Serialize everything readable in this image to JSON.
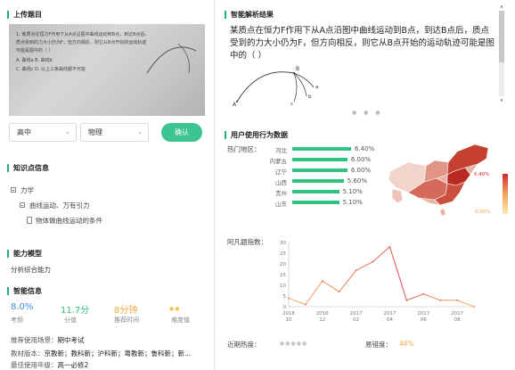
{
  "left": {
    "upload_title": "上传题目",
    "photo_lines": [
      "1. 某质点在恒力F作用下从A点沿图中曲线运动到B点，到达B点后，",
      "质点受到的力大小仍为F，但方向相反，则它从B点开始的运动轨迹",
      "可能是图中的（  ）",
      "A. 曲线a        B. 曲线b",
      "C. 曲线c        D. 以上三条曲线都不可能"
    ],
    "grade_select": "高中",
    "subject_select": "物理",
    "confirm_label": "确认",
    "knowledge_title": "知识点信息",
    "knowledge_tree": [
      "力学",
      "曲线运动、万有引力",
      "物体做曲线运动的条件"
    ],
    "ability_title": "能力模型",
    "ability_value": "分析综合能力",
    "smart_title": "智能信息",
    "stats": [
      {
        "value": "8.0%",
        "label": "考频",
        "color": "#3d8de0"
      },
      {
        "value": "11.7分",
        "label": "分值",
        "color": "#2fbf7a"
      },
      {
        "value": "8分钟",
        "label": "推荐时间",
        "color": "#f2a93b"
      },
      {
        "value": "●●",
        "label": "难度值",
        "color": "#f2c94c"
      }
    ],
    "recommend_label": "推荐使用场景：",
    "recommend_value": "期中考试",
    "textbook_label": "教材版本：",
    "textbook_value": "京教新；教科新；沪科新；粤教新；鲁科新；新...",
    "grade_label": "最佳使用年级：",
    "grade_value": "高一必修2"
  },
  "right": {
    "analysis_title": "智能解析结果",
    "question_text": "某质点在恒力F作用下从A点沿图中曲线运动到B点，到达B点后，质点受到的力大小仍为F，但方向相反，则它从B点开始的运动轨迹可能是图中的（  ）",
    "figure_labels": [
      "A",
      "B",
      "a",
      "b",
      "c"
    ],
    "carousel_dots": "● ● ●",
    "behavior_title": "用户使用行为数据",
    "hot_region_label": "热门地区：",
    "regions": [
      {
        "name": "河北",
        "pct": "6.40%",
        "value": 6.4
      },
      {
        "name": "内蒙古",
        "pct": "6.00%",
        "value": 6.0
      },
      {
        "name": "辽宁",
        "pct": "6.00%",
        "value": 6.0
      },
      {
        "name": "山西",
        "pct": "5.60%",
        "value": 5.6
      },
      {
        "name": "贵州",
        "pct": "5.10%",
        "value": 5.1
      },
      {
        "name": "山东",
        "pct": "5.10%",
        "value": 5.1
      }
    ],
    "map_legend_max": "6.40%",
    "map_legend_min": "0.00%",
    "index_label": "阿凡题指数：",
    "recent_heat_label": "近期热度：",
    "heat_dots": "●●●●●",
    "ease_label": "易错度：",
    "ease_value": "44%"
  },
  "chart_data": {
    "type": "line",
    "x": [
      "2016-10",
      "2016-11",
      "2016-12",
      "2017-01",
      "2017-02",
      "2017-03",
      "2017-04",
      "2017-05",
      "2017-06",
      "2017-07",
      "2017-08",
      "2017-09"
    ],
    "x_tick_labels": [
      {
        "year": "2016",
        "month": "10"
      },
      {
        "year": "2016",
        "month": "12"
      },
      {
        "year": "2017",
        "month": "02"
      },
      {
        "year": "2017",
        "month": "04"
      },
      {
        "year": "2017",
        "month": "06"
      },
      {
        "year": "2017",
        "month": "08"
      }
    ],
    "values": [
      4,
      1,
      12,
      7,
      17,
      21,
      28,
      3,
      6,
      3,
      3,
      0
    ],
    "ylim": [
      0,
      30
    ],
    "yticks": [
      0,
      5,
      10,
      15,
      20,
      25,
      30
    ],
    "line_color_start": "#f6b36b",
    "line_color_end": "#e0554e",
    "grid": false
  }
}
